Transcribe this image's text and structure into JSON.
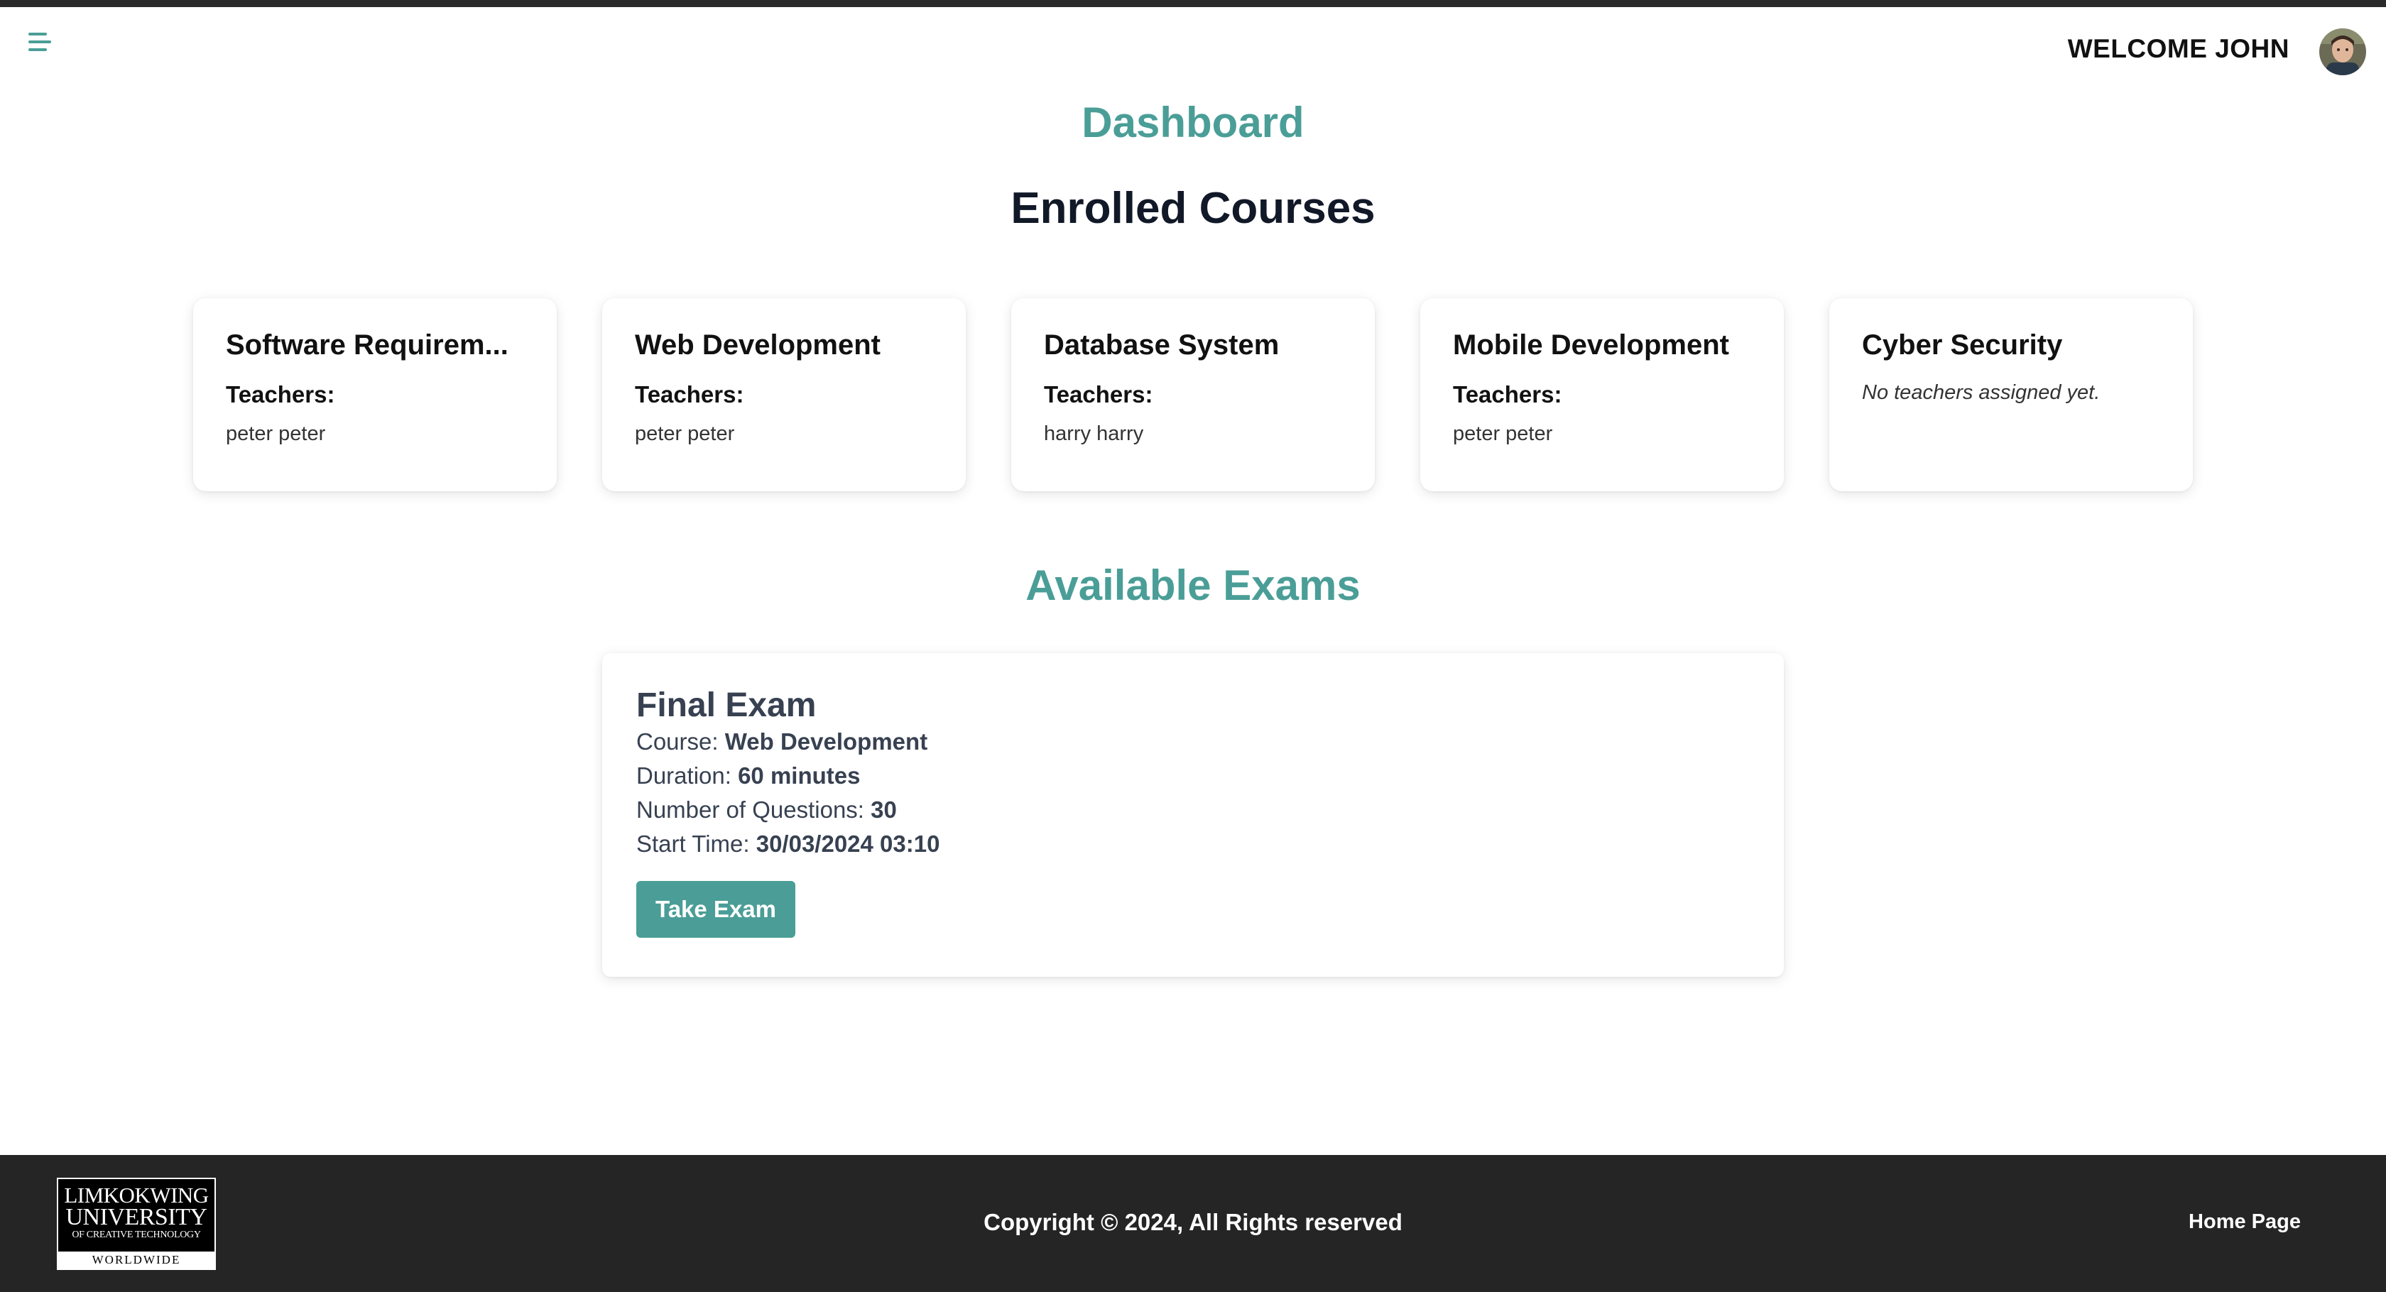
{
  "header": {
    "welcome_text": "WELCOME JOHN",
    "menu_icon": "hamburger-menu-icon",
    "avatar_icon": "user-avatar"
  },
  "page": {
    "title": "Dashboard",
    "courses_heading": "Enrolled Courses",
    "exams_heading": "Available Exams"
  },
  "courses": [
    {
      "title": "Software Requirem...",
      "teachers_label": "Teachers:",
      "teachers": "peter peter"
    },
    {
      "title": "Web Development",
      "teachers_label": "Teachers:",
      "teachers": "peter peter"
    },
    {
      "title": "Database System",
      "teachers_label": "Teachers:",
      "teachers": "harry harry"
    },
    {
      "title": "Mobile Development",
      "teachers_label": "Teachers:",
      "teachers": "peter peter"
    },
    {
      "title": "Cyber Security",
      "no_teachers": "No teachers assigned yet."
    }
  ],
  "exam": {
    "title": "Final Exam",
    "course_label": "Course:",
    "course_value": "Web Development",
    "duration_label": "Duration:",
    "duration_value": "60 minutes",
    "questions_label": "Number of Questions:",
    "questions_value": "30",
    "start_label": "Start Time:",
    "start_value": "30/03/2024 03:10",
    "button_label": "Take Exam"
  },
  "footer": {
    "logo_line1": "LIMKOKWING",
    "logo_line2": "UNIVERSITY",
    "logo_line3": "OF CREATIVE TECHNOLOGY",
    "logo_line4": "WORLDWIDE",
    "copyright": "Copyright © 2024, All Rights reserved",
    "home_link": "Home Page"
  },
  "colors": {
    "accent": "#4a9e97",
    "footer_bg": "#252525",
    "top_strip": "#2a2a2a"
  }
}
